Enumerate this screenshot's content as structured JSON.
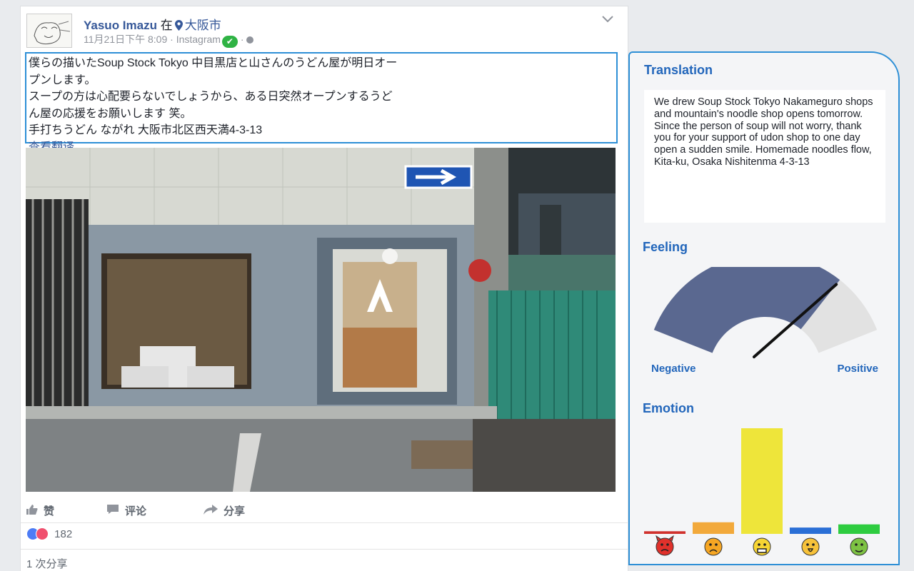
{
  "post": {
    "author": "Yasuo Imazu",
    "at_word": "在",
    "location": "大阪市",
    "timestamp": "11月21日下午 8:09",
    "separator": "·",
    "source": "Instagram",
    "text_lines": [
      "僕らの描いたSoup Stock Tokyo 中目黒店と山さんのうどん屋が明日オー",
      "プンします。",
      "スープの方は心配要らないでしょうから、ある日突然オープンするうど",
      "ん屋の応援をお願いします 笑。",
      "手打ちうどん ながれ 大阪市北区西天満4-3-13"
    ],
    "see_translation": "查看翻译",
    "actions": {
      "like": "赞",
      "comment": "评论",
      "share": "分享"
    },
    "reaction_count": "182",
    "share_count": "1 次分享",
    "icons": {
      "location": "map-pin-icon",
      "verified": "check-icon",
      "privacy": "globe-icon",
      "menu": "chevron-down-icon",
      "like": "thumbs-up-icon",
      "comment": "comment-icon",
      "share": "share-arrow-icon"
    },
    "colors": {
      "link": "#365899",
      "verified": "#2fb344"
    }
  },
  "panel": {
    "translation_title": "Translation",
    "translation_text": "We drew Soup Stock Tokyo Nakameguro shops and mountain's noodle shop opens tomorrow. Since the person of soup will not worry, thank you for your support of udon shop to one day open a sudden smile. Homemade noodles flow, Kita-ku, Osaka Nishitenma 4-3-13",
    "feeling_title": "Feeling",
    "feeling": {
      "negative_label": "Negative",
      "positive_label": "Positive",
      "value": 0.78,
      "colors": {
        "fill": "#5a6890",
        "track": "#e2e2e2",
        "needle": "#111111"
      }
    },
    "emotion_title": "Emotion",
    "accent": "#2d8fd6"
  },
  "chart_data": {
    "type": "bar",
    "categories": [
      "anger",
      "sadness",
      "joy",
      "fear",
      "disgust"
    ],
    "values": [
      0.025,
      0.11,
      1.0,
      0.06,
      0.09
    ],
    "colors": [
      "#d0312d",
      "#f2a93b",
      "#eee53a",
      "#2a6fd6",
      "#2ecc40"
    ],
    "emoji_icons": [
      "angry-devil-emoji-icon",
      "sad-face-emoji-icon",
      "grimace-face-emoji-icon",
      "fearful-face-emoji-icon",
      "sick-face-emoji-icon"
    ],
    "ylim": [
      0,
      1
    ]
  }
}
